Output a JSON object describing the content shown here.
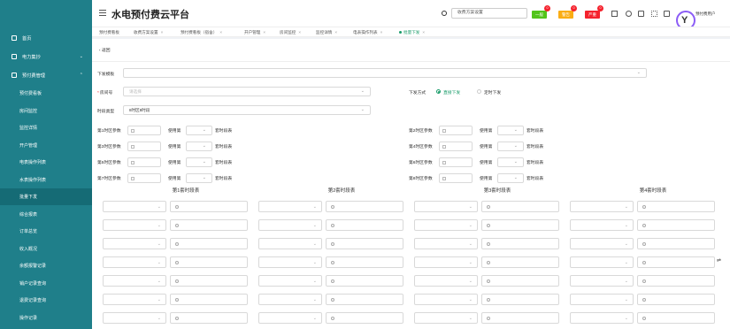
{
  "app": {
    "title": "水电预付费云平台"
  },
  "header": {
    "search_value": "收费方案设置",
    "badges": [
      {
        "label": "一般",
        "count": "0",
        "color": "#52c41a"
      },
      {
        "label": "警告",
        "count": "0",
        "color": "#faad14"
      },
      {
        "label": "严重",
        "count": "0",
        "color": "#f5222d"
      }
    ],
    "user": "预付费用户"
  },
  "sidebar": {
    "items": [
      {
        "label": "首页"
      },
      {
        "label": "电力集抄"
      },
      {
        "label": "预付费管理"
      }
    ],
    "subitems": [
      {
        "label": "预付费看板"
      },
      {
        "label": "房间监控"
      },
      {
        "label": "监控详情"
      },
      {
        "label": "开户管理"
      },
      {
        "label": "电表操作列表"
      },
      {
        "label": "水表操作列表"
      },
      {
        "label": "批量下发"
      },
      {
        "label": "综合报表"
      },
      {
        "label": "订单总览"
      },
      {
        "label": "收入概况"
      },
      {
        "label": "余额报警记录"
      },
      {
        "label": "销户记录查询"
      },
      {
        "label": "退费记录查询"
      },
      {
        "label": "操作记录"
      }
    ]
  },
  "tabs": [
    {
      "label": "预付费看板"
    },
    {
      "label": "收费方案设置"
    },
    {
      "label": "预付费看板（宿舍）"
    },
    {
      "label": "开户管理"
    },
    {
      "label": "房间监控"
    },
    {
      "label": "监控详情"
    },
    {
      "label": "电表操作列表"
    },
    {
      "label": "批量下发"
    }
  ],
  "form": {
    "back": "返回",
    "template_label": "下发模板",
    "room_label": "房间号",
    "room_placeholder": "请选择",
    "mode_label": "下发方式",
    "mode_direct": "直接下发",
    "mode_timed": "定时下发",
    "period_type_label": "时段类型",
    "period_type_value": "8时区8时段",
    "use_label": "使用第",
    "suffix_label": "套时段表",
    "params": [
      "第1时区参数",
      "第2时区参数",
      "第3时区参数",
      "第4时区参数",
      "第5时区参数",
      "第6时区参数",
      "第7时区参数",
      "第8时区参数"
    ]
  },
  "sets": [
    {
      "title": "第1套时段表"
    },
    {
      "title": "第2套时段表"
    },
    {
      "title": "第3套时段表"
    },
    {
      "title": "第4套时段表"
    }
  ]
}
